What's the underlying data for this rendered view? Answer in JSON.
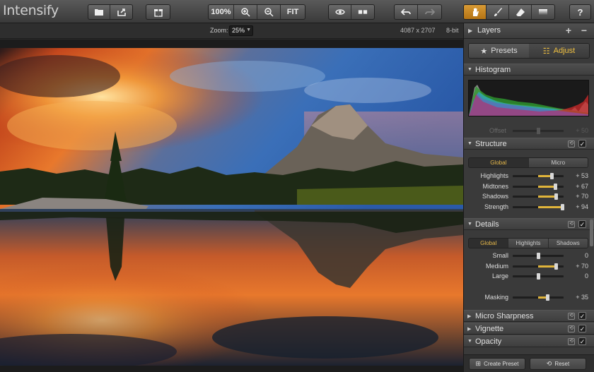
{
  "app": {
    "title": "Intensify"
  },
  "toolbar": {
    "zoom_percent": "100%",
    "fit_label": "FIT"
  },
  "subbar": {
    "zoom_label": "Zoom:",
    "zoom_value": "25%",
    "dimensions": "4087 x 2707",
    "bit_depth": "8-bit"
  },
  "panel": {
    "layers_label": "Layers",
    "tabs": [
      {
        "label": "Presets",
        "icon": "star-icon",
        "active": false
      },
      {
        "label": "Adjust",
        "icon": "sliders-icon",
        "active": true
      }
    ],
    "histogram_label": "Histogram",
    "offset_label": "Offset",
    "offset_value": "+ 50",
    "structure": {
      "label": "Structure",
      "segments": [
        "Global",
        "Micro"
      ],
      "active_segment": "Global",
      "sliders": [
        {
          "label": "Highlights",
          "value": "+ 53",
          "level": 53
        },
        {
          "label": "Midtones",
          "value": "+ 67",
          "level": 67
        },
        {
          "label": "Shadows",
          "value": "+ 70",
          "level": 70
        },
        {
          "label": "Strength",
          "value": "+ 94",
          "level": 94
        }
      ]
    },
    "details": {
      "label": "Details",
      "segments": [
        "Global",
        "Highlights",
        "Shadows"
      ],
      "active_segment": "Global",
      "sliders": [
        {
          "label": "Small",
          "value": "0",
          "level": 0
        },
        {
          "label": "Medium",
          "value": "+ 70",
          "level": 70
        },
        {
          "label": "Large",
          "value": "0",
          "level": 0
        }
      ],
      "masking": {
        "label": "Masking",
        "value": "+ 35",
        "level": 35
      }
    },
    "collapsed_sections": [
      "Micro Sharpness",
      "Vignette",
      "Opacity"
    ],
    "create_preset_label": "Create Preset",
    "reset_label": "Reset"
  },
  "colors": {
    "accent": "#e0b43a",
    "active_tool": "#c9861f"
  }
}
